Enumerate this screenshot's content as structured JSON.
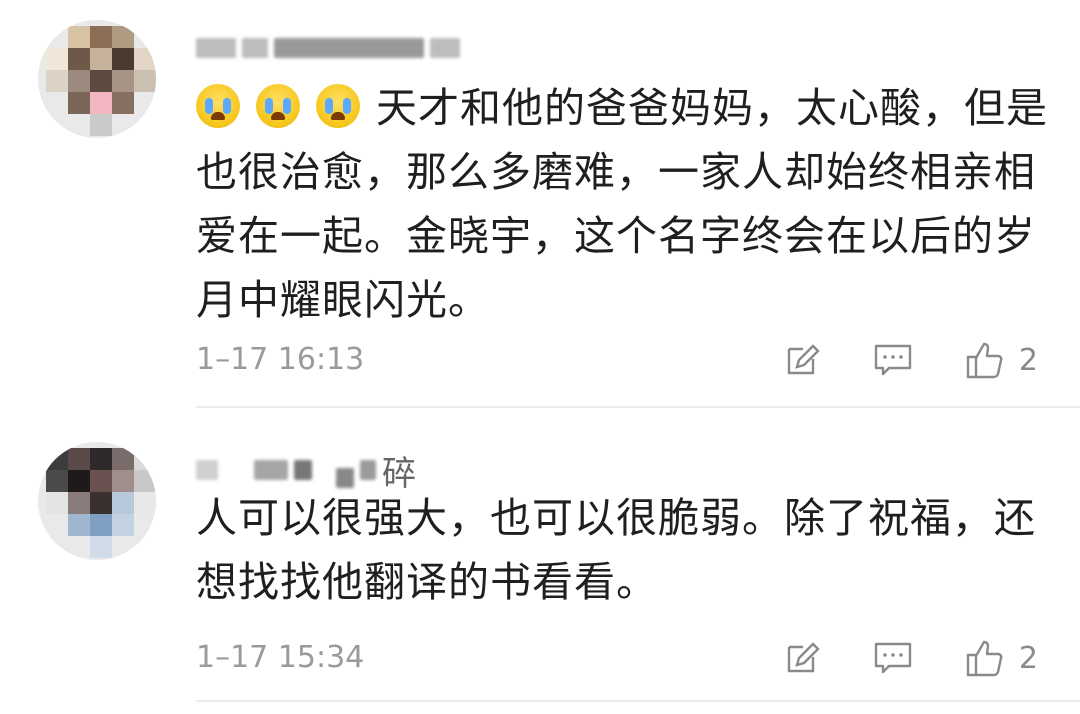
{
  "comments": [
    {
      "username_suffix": "",
      "text": "天才和他的爸爸妈妈，太心酸，但是也很治愈，那么多磨难，一家人却始终相亲相爱在一起。金晓宇，这个名字终会在以后的岁月中耀眼闪光。",
      "emoji": [
        "crying-face-icon",
        "crying-face-icon",
        "crying-face-icon"
      ],
      "time": "1–17 16:13",
      "likes": "2"
    },
    {
      "username_suffix": "碎",
      "text": "人可以很强大，也可以很脆弱。除了祝福，还想找找他翻译的书看看。",
      "emoji": [],
      "time": "1–17 15:34",
      "likes": "2"
    }
  ],
  "icons": {
    "edit": "edit-icon",
    "comment": "comment-icon",
    "like": "thumbs-up-icon"
  },
  "colors": {
    "emoji_yellow": "#f5c518",
    "meta_gray": "#9a9a9a",
    "text": "#1f1f1f"
  }
}
